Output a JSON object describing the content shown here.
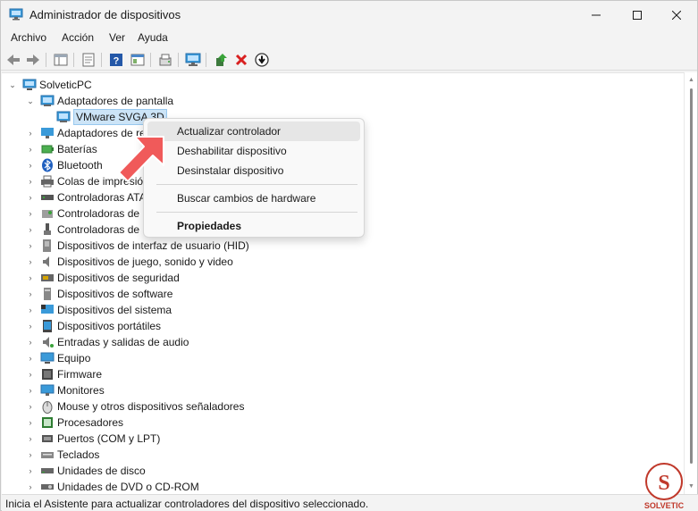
{
  "window": {
    "title": "Administrador de dispositivos"
  },
  "menubar": {
    "items": [
      "Archivo",
      "Acción",
      "Ver",
      "Ayuda"
    ]
  },
  "toolbar": {
    "buttons": [
      "back-arrow-icon",
      "forward-arrow-icon",
      "properties-icon",
      "document-icon",
      "help-icon",
      "view-icon",
      "scan-icon",
      "monitor-icon",
      "update-driver-icon",
      "uninstall-icon",
      "disable-icon"
    ]
  },
  "tree": {
    "root": "SolveticPC",
    "display_adapters": "Adaptadores de pantalla",
    "selected_device": "VMware SVGA 3D",
    "categories": [
      "Adaptadores de re",
      "Baterías",
      "Bluetooth",
      "Colas de impresió",
      "Controladoras ATA",
      "Controladoras de",
      "Controladoras de",
      "Dispositivos de interfaz de usuario (HID)",
      "Dispositivos de juego, sonido y video",
      "Dispositivos de seguridad",
      "Dispositivos de software",
      "Dispositivos del sistema",
      "Dispositivos portátiles",
      "Entradas y salidas de audio",
      "Equipo",
      "Firmware",
      "Monitores",
      "Mouse y otros dispositivos señaladores",
      "Procesadores",
      "Puertos (COM y LPT)",
      "Teclados",
      "Unidades de disco",
      "Unidades de DVD o CD-ROM"
    ]
  },
  "context_menu": {
    "update_driver": "Actualizar controlador",
    "disable_device": "Deshabilitar dispositivo",
    "uninstall_device": "Desinstalar dispositivo",
    "scan_hardware": "Buscar cambios de hardware",
    "properties": "Propiedades"
  },
  "statusbar": {
    "text": "Inicia el Asistente para actualizar controladores del dispositivo seleccionado."
  },
  "watermark": {
    "text": "SOLVETIC"
  },
  "colors": {
    "selection": "#cce4f7",
    "accent_arrow": "#f05a5a",
    "uninstall_red": "#d92020"
  }
}
